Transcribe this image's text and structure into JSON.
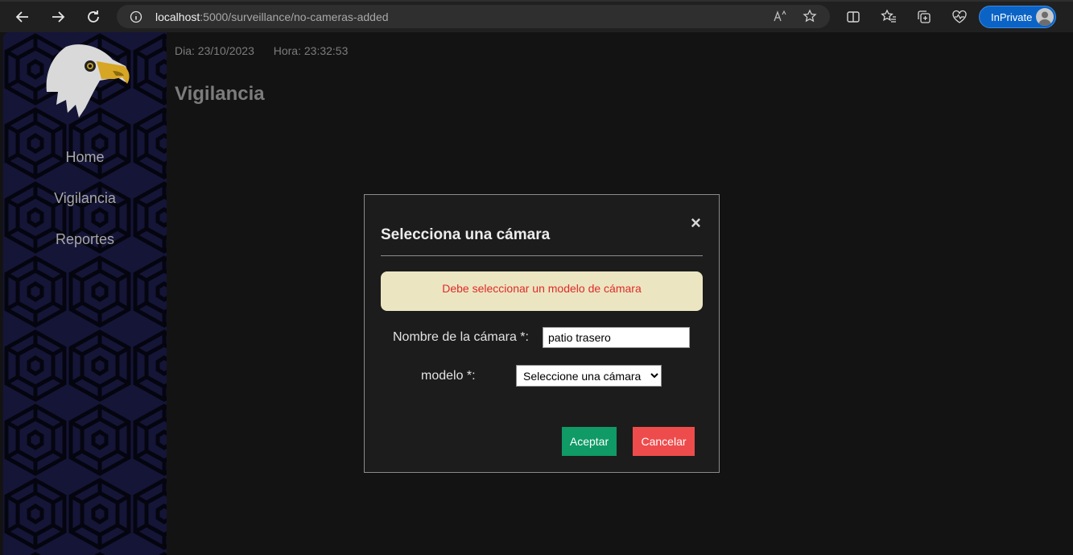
{
  "browser": {
    "url_host": "localhost",
    "url_path": ":5000/surveillance/no-cameras-added",
    "inprivate_label": "InPrivate"
  },
  "sidebar": {
    "items": [
      {
        "label": "Home"
      },
      {
        "label": "Vigilancia"
      },
      {
        "label": "Reportes"
      }
    ]
  },
  "header": {
    "date": "Dia: 23/10/2023",
    "time": "Hora: 23:32:53",
    "title": "Vigilancia"
  },
  "modal": {
    "title": "Selecciona una cámara",
    "close_symbol": "×",
    "alert": "Debe seleccionar un modelo de cámara",
    "name_label": "Nombre de la cámara *:",
    "name_value": "patio trasero",
    "model_label": "modelo *:",
    "model_selected": "Seleccione una cámara",
    "accept_label": "Aceptar",
    "cancel_label": "Cancelar"
  },
  "colors": {
    "sidebar_bg": "#151538",
    "accept": "#0f9a66",
    "cancel": "#ee4c4c",
    "alert_bg": "#ebe6c1",
    "alert_text": "#e02a2a"
  }
}
